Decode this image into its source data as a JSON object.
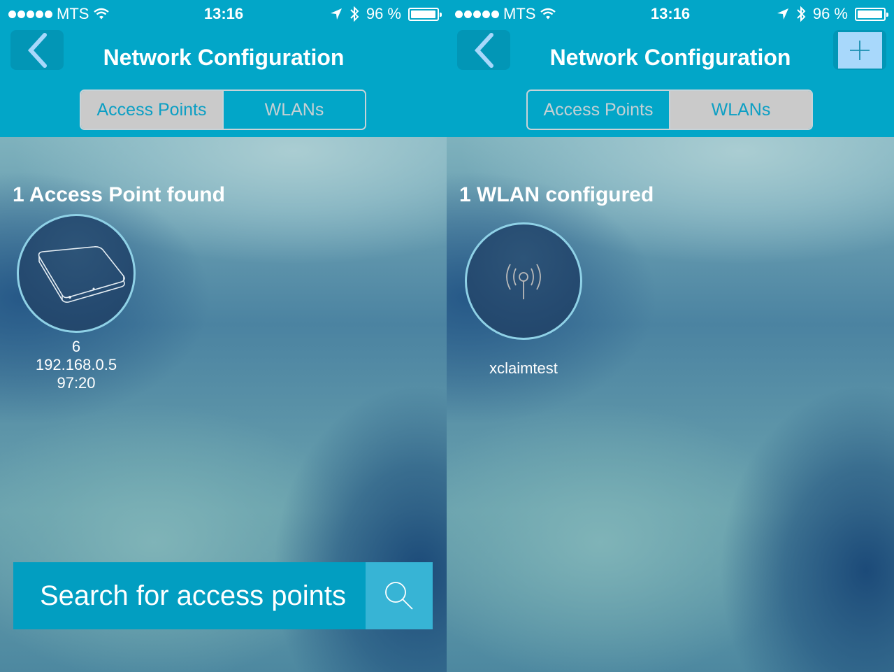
{
  "status_bar": {
    "carrier": "MTS",
    "time": "13:16",
    "battery_text": "96 %",
    "battery_level_percent": 96,
    "signal_dots": 5,
    "icons": [
      "signal-dots-icon",
      "wifi-icon",
      "location-arrow-icon",
      "bluetooth-icon",
      "battery-icon"
    ]
  },
  "colors": {
    "header": "#02a6c8",
    "segment_active_bg": "#cacaca",
    "segment_active_text": "#0c9fc4",
    "circle_border": "#8fd1e6",
    "search_bg": "#029ec1",
    "search_button_bg": "#37b4d5"
  },
  "screens": [
    {
      "title": "Network Configuration",
      "back_icon": "chevron-left-icon",
      "tabs": [
        {
          "label": "Access Points",
          "active": true
        },
        {
          "label": "WLANs",
          "active": false
        }
      ],
      "section_title": "1 Access Point found",
      "items": [
        {
          "icon": "access-point-device-icon",
          "lines": [
            "6",
            "192.168.0.5",
            "97:20"
          ]
        }
      ],
      "search": {
        "label": "Search for access points",
        "icon": "search-icon"
      }
    },
    {
      "title": "Network Configuration",
      "back_icon": "chevron-left-icon",
      "add_icon": "plus-icon",
      "tabs": [
        {
          "label": "Access Points",
          "active": false
        },
        {
          "label": "WLANs",
          "active": true
        }
      ],
      "section_title": "1 WLAN configured",
      "items": [
        {
          "icon": "wireless-antenna-icon",
          "name": "xclaimtest"
        }
      ]
    }
  ]
}
